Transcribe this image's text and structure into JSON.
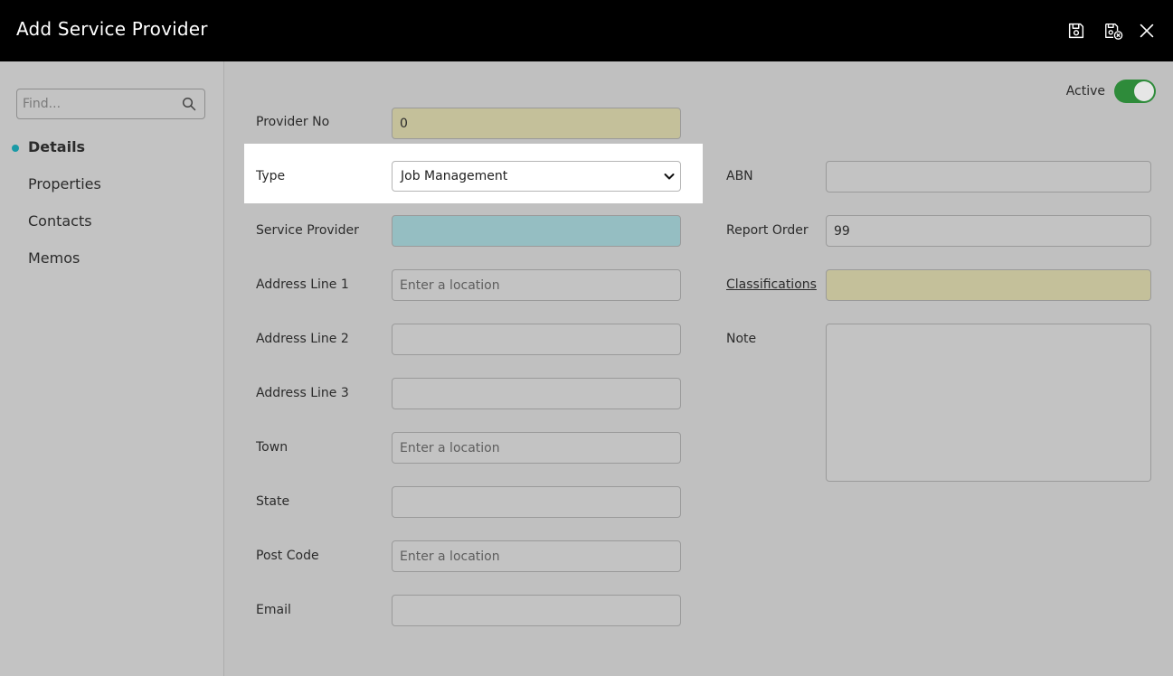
{
  "window": {
    "title": "Add Service Provider"
  },
  "toolbar": {
    "save_icon": "save-icon",
    "save_close_icon": "save-close-icon",
    "close_icon": "close-icon"
  },
  "sidebar": {
    "search": {
      "placeholder": "Find..."
    },
    "items": [
      {
        "label": "Details",
        "active": true
      },
      {
        "label": "Properties"
      },
      {
        "label": "Contacts"
      },
      {
        "label": "Memos"
      }
    ]
  },
  "form": {
    "active": {
      "label": "Active",
      "on": true
    },
    "provider_no": {
      "label": "Provider No",
      "value": "0"
    },
    "type": {
      "label": "Type",
      "value": "Job Management"
    },
    "service_provider": {
      "label": "Service Provider",
      "value": ""
    },
    "address1": {
      "label": "Address Line 1",
      "placeholder": "Enter a location"
    },
    "address2": {
      "label": "Address Line 2",
      "value": ""
    },
    "address3": {
      "label": "Address Line 3",
      "value": ""
    },
    "town": {
      "label": "Town",
      "placeholder": "Enter a location"
    },
    "state": {
      "label": "State",
      "value": ""
    },
    "postcode": {
      "label": "Post Code",
      "placeholder": "Enter a location"
    },
    "email": {
      "label": "Email",
      "value": ""
    },
    "abn": {
      "label": "ABN",
      "value": ""
    },
    "report_order": {
      "label": "Report Order",
      "value": "99"
    },
    "classifications": {
      "label": "Classifications",
      "value": ""
    },
    "note": {
      "label": "Note",
      "value": ""
    }
  },
  "colors": {
    "accent": "#1a9aa6",
    "toggle_on": "#2e8b3a",
    "required_field": "#c4c09a",
    "key_field": "#95bec2"
  }
}
